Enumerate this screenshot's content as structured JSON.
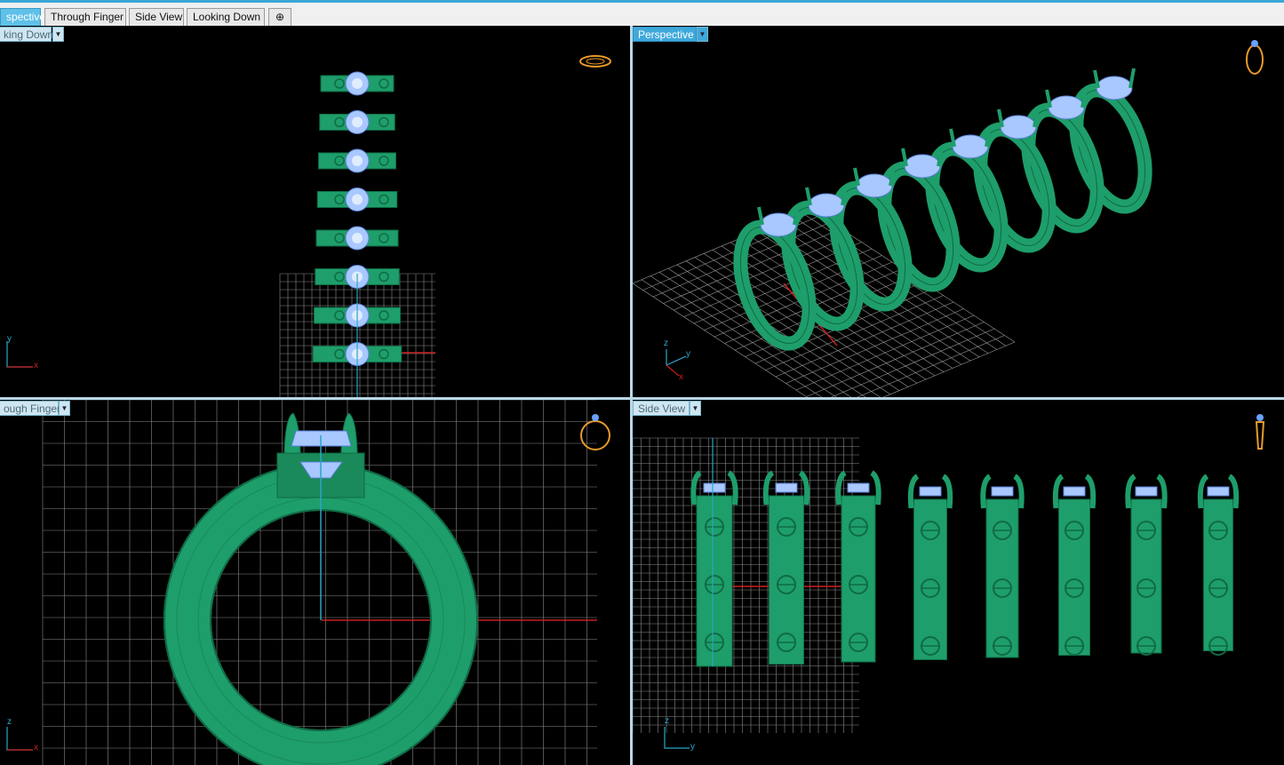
{
  "tabs": [
    {
      "label": "spective",
      "active": true
    },
    {
      "label": "Through Finger",
      "active": false
    },
    {
      "label": "Side View",
      "active": false
    },
    {
      "label": "Looking Down",
      "active": false
    }
  ],
  "add_tab_icon": "plus-icon",
  "viewports": {
    "top_left": {
      "label": "king Down",
      "axes": {
        "v": "y",
        "h": "x"
      }
    },
    "top_right": {
      "label": "Perspective",
      "axes": {
        "a": "z",
        "b": "y",
        "c": "x"
      }
    },
    "bottom_left": {
      "label": "ough Finger",
      "axes": {
        "v": "z",
        "h": "x"
      }
    },
    "bottom_right": {
      "label": "Side View",
      "axes": {
        "v": "z",
        "h": "y"
      }
    }
  },
  "colors": {
    "ring_green": "#1e9e6a",
    "stone_blue": "#a8c8ff",
    "grid": "#8a8a8a",
    "axis_red": "#cc1f1f",
    "axis_cyan": "#2aa6c8",
    "nav_orange": "#e89a2a"
  },
  "ring_count": 8
}
